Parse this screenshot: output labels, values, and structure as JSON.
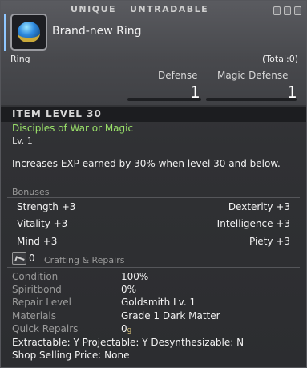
{
  "flags": {
    "unique": "UNIQUE",
    "untradable": "UNTRADABLE"
  },
  "item": {
    "name": "Brand-new Ring",
    "category": "Ring",
    "total": "(Total:0)",
    "icon": "ring-icon"
  },
  "stats": {
    "defense_label": "Defense",
    "defense_value": "1",
    "magic_defense_label": "Magic Defense",
    "magic_defense_value": "1"
  },
  "item_level": "ITEM LEVEL 30",
  "classes": "Disciples of War or Magic",
  "level": "Lv. 1",
  "description": "Increases EXP earned by 30% when level 30 and below.",
  "bonuses": {
    "title": "Bonuses",
    "left": [
      "Strength +3",
      "Vitality +3",
      "Mind +3"
    ],
    "right": [
      "Dexterity +3",
      "Intelligence +3",
      "Piety +3"
    ]
  },
  "crafting": {
    "count": "0",
    "title": "Crafting & Repairs",
    "rows": [
      {
        "label": "Condition",
        "value": "100%"
      },
      {
        "label": "Spiritbond",
        "value": "0%"
      },
      {
        "label": "Repair Level",
        "value": "Goldsmith Lv. 1"
      },
      {
        "label": "Materials",
        "value": "Grade 1 Dark Matter"
      },
      {
        "label": "Quick Repairs",
        "value": "0"
      }
    ],
    "gil_symbol": "g"
  },
  "footer": {
    "line1": "Extractable: Y  Projectable: Y  Desynthesizable: N",
    "line2": "Shop Selling Price: None"
  },
  "colors": {
    "classes": "#9be36a",
    "accent": "#8fc7ff"
  }
}
